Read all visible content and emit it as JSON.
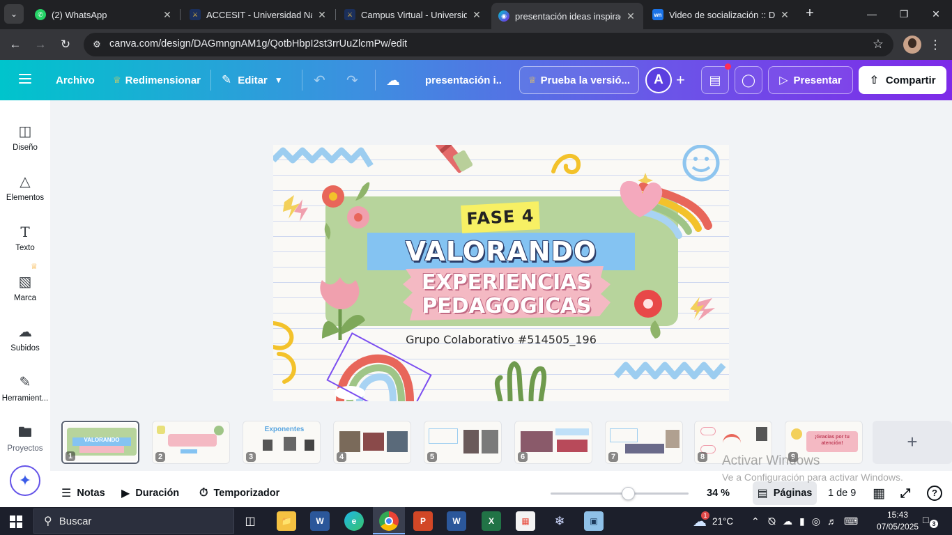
{
  "browser": {
    "tabs": [
      {
        "title": "(2) WhatsApp",
        "icon": "whatsapp-icon",
        "active": false
      },
      {
        "title": "ACCESIT - Universidad Nacio",
        "icon": "accesit-icon",
        "active": false
      },
      {
        "title": "Campus Virtual - Universidad",
        "icon": "campus-icon",
        "active": false
      },
      {
        "title": "presentación ideas inspirado",
        "icon": "canva-icon",
        "active": true
      },
      {
        "title": "Video de socialización :: DES",
        "icon": "wn-icon",
        "active": false
      }
    ],
    "wn_favicon": "wn",
    "url": "canva.com/design/DAGmngnAM1g/QotbHbpI2st3rrUuZlcmPw/edit"
  },
  "canva_header": {
    "menu_label": "Archivo",
    "resize_label": "Redimensionar",
    "edit_label": "Editar",
    "doc_title": "presentación i...",
    "trial_label": "Prueba la versió...",
    "avatar_letter": "A",
    "present_label": "Presentar",
    "share_label": "Compartir"
  },
  "sidebar": {
    "items": [
      {
        "label": "Diseño",
        "icon": "design-icon"
      },
      {
        "label": "Elementos",
        "icon": "elements-icon"
      },
      {
        "label": "Texto",
        "icon": "text-icon"
      },
      {
        "label": "Marca",
        "icon": "brand-icon"
      },
      {
        "label": "Subidos",
        "icon": "uploads-icon"
      },
      {
        "label": "Herramient...",
        "icon": "tools-icon"
      },
      {
        "label": "Proyectos",
        "icon": "projects-icon"
      }
    ]
  },
  "slide": {
    "phase": "FASE 4",
    "title": "VALORANDO",
    "subtitle_line1": "EXPERIENCIAS",
    "subtitle_line2": "PEDAGOGICAS",
    "group": "Grupo Colaborativo #514505_196"
  },
  "thumbnails": [
    {
      "num": "1",
      "selected": true,
      "heading": "VALORANDO",
      "kind": "cover"
    },
    {
      "num": "2",
      "selected": false,
      "heading": "",
      "kind": "intro"
    },
    {
      "num": "3",
      "selected": false,
      "heading": "Exponentes",
      "kind": "people"
    },
    {
      "num": "4",
      "selected": false,
      "heading": "",
      "kind": "photos"
    },
    {
      "num": "5",
      "selected": false,
      "heading": "",
      "kind": "photos"
    },
    {
      "num": "6",
      "selected": false,
      "heading": "",
      "kind": "photos"
    },
    {
      "num": "7",
      "selected": false,
      "heading": "",
      "kind": "photos"
    },
    {
      "num": "8",
      "selected": false,
      "heading": "",
      "kind": "map"
    },
    {
      "num": "9",
      "selected": false,
      "heading": "¡Gracias por tu atención!",
      "kind": "thanks"
    }
  ],
  "footer": {
    "notes_label": "Notas",
    "duration_label": "Duración",
    "timer_label": "Temporizador",
    "zoom": "34 %",
    "zoom_fraction": 0.34,
    "pages_label": "Páginas",
    "page_counter": "1 de 9"
  },
  "windows_watermark": {
    "line1": "Activar Windows",
    "line2": "Ve a Configuración para activar Windows."
  },
  "taskbar": {
    "search_placeholder": "Buscar",
    "weather_temp": "21°C",
    "weather_badge": "1",
    "time": "15:43",
    "date": "07/05/2025",
    "notif_count": "3"
  }
}
